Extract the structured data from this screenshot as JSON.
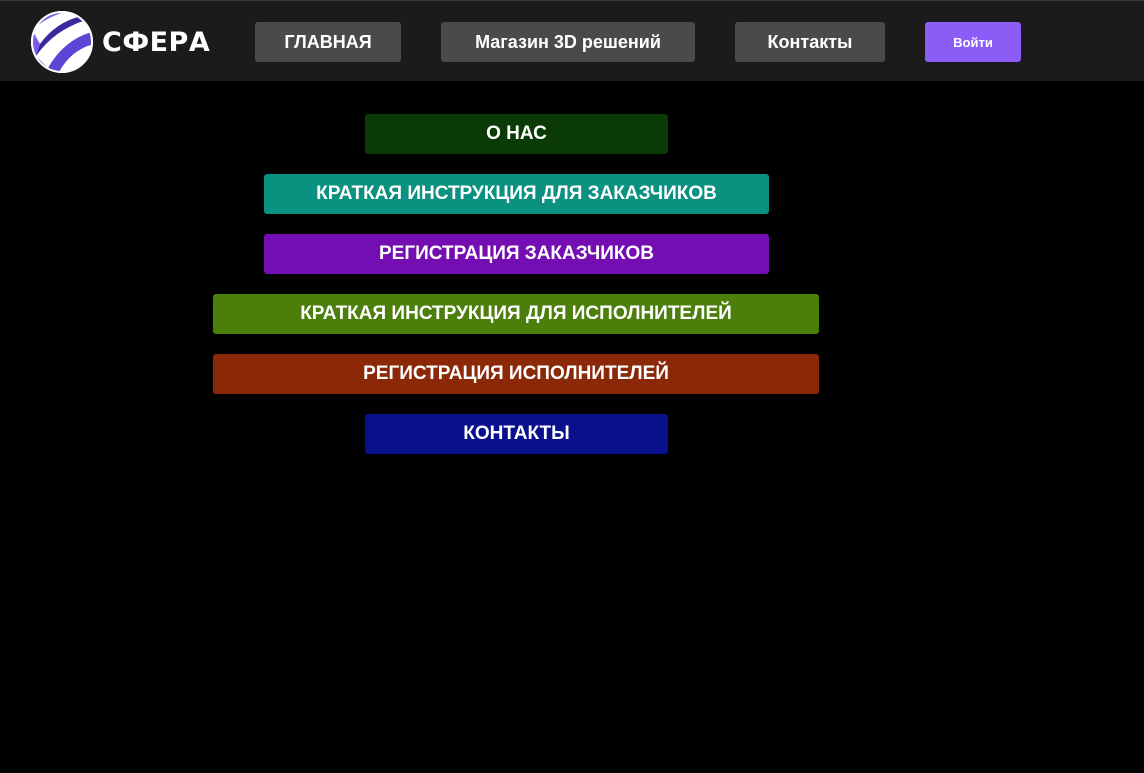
{
  "header": {
    "logo_text": "СФЕРА",
    "logo_icon": "striped-sphere-icon",
    "nav": {
      "home": "ГЛАВНАЯ",
      "shop": "Магазин 3D решений",
      "contacts": "Контакты"
    },
    "login_label": "Войти",
    "login_color": "#8c5cf6"
  },
  "menu": {
    "about": {
      "label": "О НАС",
      "color": "#0a3a05"
    },
    "customer_guide": {
      "label": "КРАТКАЯ ИНСТРУКЦИЯ ДЛЯ ЗАКАЗЧИКОВ",
      "color": "#0a9180"
    },
    "customer_registration": {
      "label": "РЕГИСТРАЦИЯ ЗАКАЗЧИКОВ",
      "color": "#740eb2"
    },
    "performer_guide": {
      "label": "КРАТКАЯ ИНСТРУКЦИЯ ДЛЯ ИСПОЛНИТЕЛЕЙ",
      "color": "#4b7e0a"
    },
    "performer_registration": {
      "label": "РЕГИСТРАЦИЯ ИСПОЛНИТЕЛЕЙ",
      "color": "#8a2808"
    },
    "contacts": {
      "label": "КОНТАКТЫ",
      "color": "#0a0f8e"
    }
  }
}
